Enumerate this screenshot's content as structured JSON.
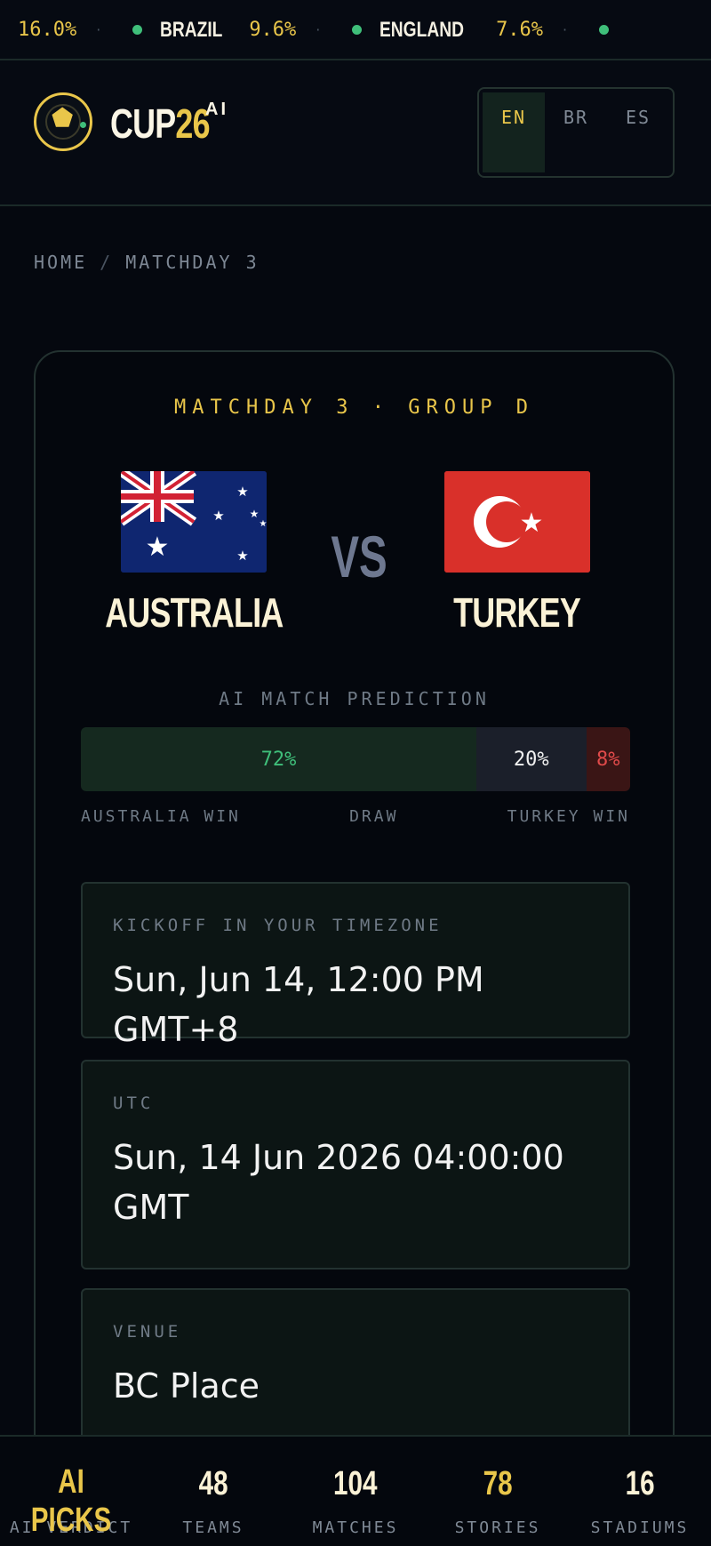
{
  "ticker": [
    {
      "team": "",
      "pct": "16.0%"
    },
    {
      "team": "BRAZIL",
      "pct": "9.6%"
    },
    {
      "team": "ENGLAND",
      "pct": "7.6%"
    }
  ],
  "header": {
    "logo_main": "CUP",
    "logo_num": "26",
    "logo_sup": "AI",
    "languages": [
      "EN",
      "BR",
      "ES"
    ],
    "active_language": "EN"
  },
  "breadcrumb": {
    "home": "HOME",
    "current": "MATCHDAY 3"
  },
  "match": {
    "label": "MATCHDAY 3 · GROUP D",
    "home_team": "AUSTRALIA",
    "away_team": "TURKEY",
    "vs": "VS"
  },
  "prediction": {
    "title": "AI MATCH PREDICTION",
    "home_win": 72,
    "draw": 20,
    "away_win": 8,
    "home_win_text": "72%",
    "draw_text": "20%",
    "away_win_text": "8%",
    "home_label": "AUSTRALIA WIN",
    "draw_label": "DRAW",
    "away_label": "TURKEY WIN"
  },
  "kickoff": {
    "label": "KICKOFF IN YOUR TIMEZONE",
    "value": "Sun, Jun 14, 12:00 PM GMT+8"
  },
  "utc": {
    "label": "UTC",
    "value": "Sun, 14 Jun 2026 04:00:00 GMT"
  },
  "venue": {
    "label": "VENUE",
    "value": "BC Place"
  },
  "stats": [
    {
      "value": "AI PICKS",
      "label": "AI VERDICT",
      "highlight": true
    },
    {
      "value": "48",
      "label": "TEAMS",
      "highlight": false
    },
    {
      "value": "104",
      "label": "MATCHES",
      "highlight": false
    },
    {
      "value": "78",
      "label": "STORIES",
      "highlight": true
    },
    {
      "value": "16",
      "label": "STADIUMS",
      "highlight": false
    }
  ],
  "colors": {
    "accent": "#e9c64a",
    "win": "#3fbf7a",
    "loss": "#e04a4a",
    "background": "#05080f"
  }
}
